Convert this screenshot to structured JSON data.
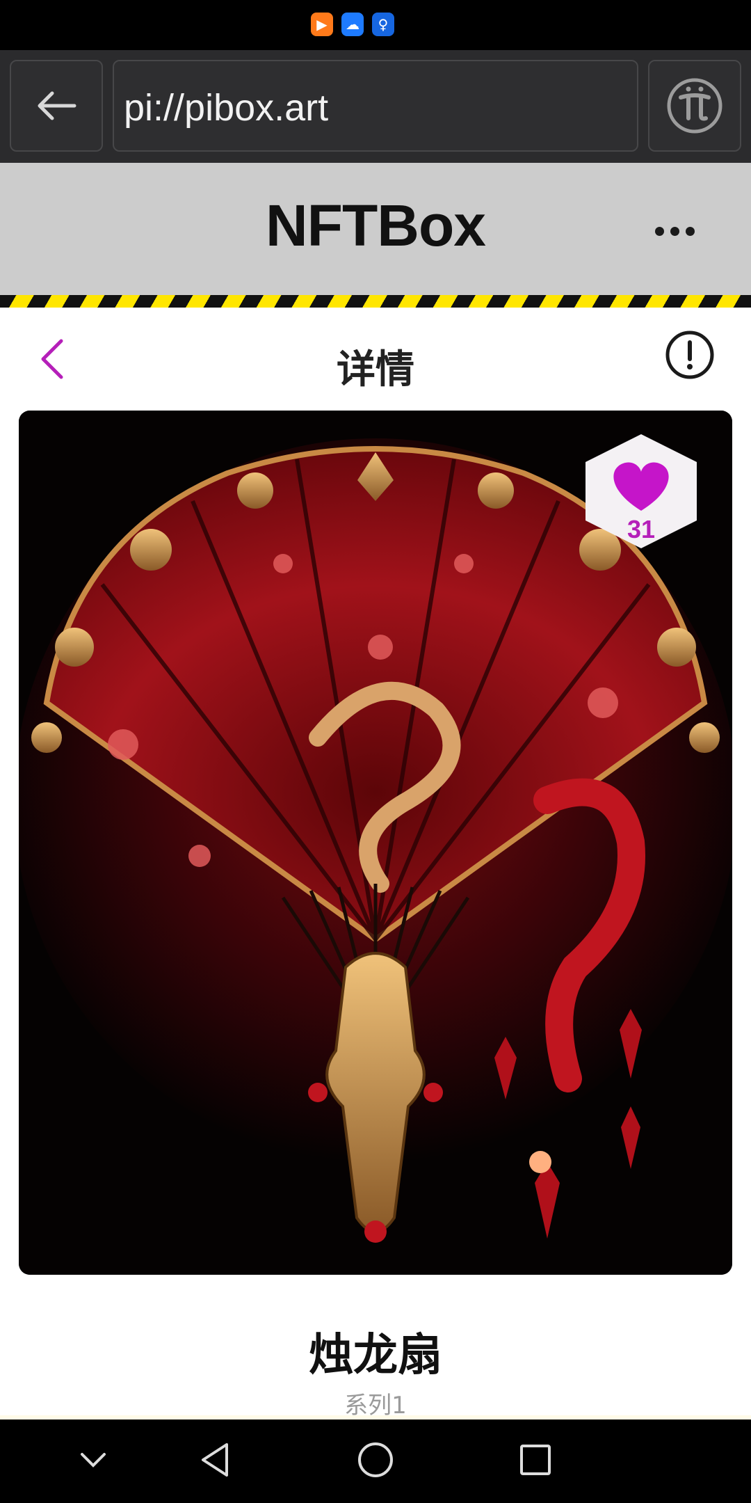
{
  "status_bar": {
    "icons": [
      "video-app-icon",
      "cloud-app-icon",
      "bulb-app-icon"
    ]
  },
  "browser": {
    "url": "pi://pibox.art"
  },
  "app": {
    "title": "NFTBox"
  },
  "detail_nav": {
    "title": "详情"
  },
  "nft": {
    "likes": "31",
    "name": "烛龙扇",
    "series": "系列1"
  },
  "colors": {
    "accent": "#b51fb9",
    "heart": "#c515c9",
    "header_bg": "#cccccc",
    "hazard_yellow": "#ffe600"
  }
}
